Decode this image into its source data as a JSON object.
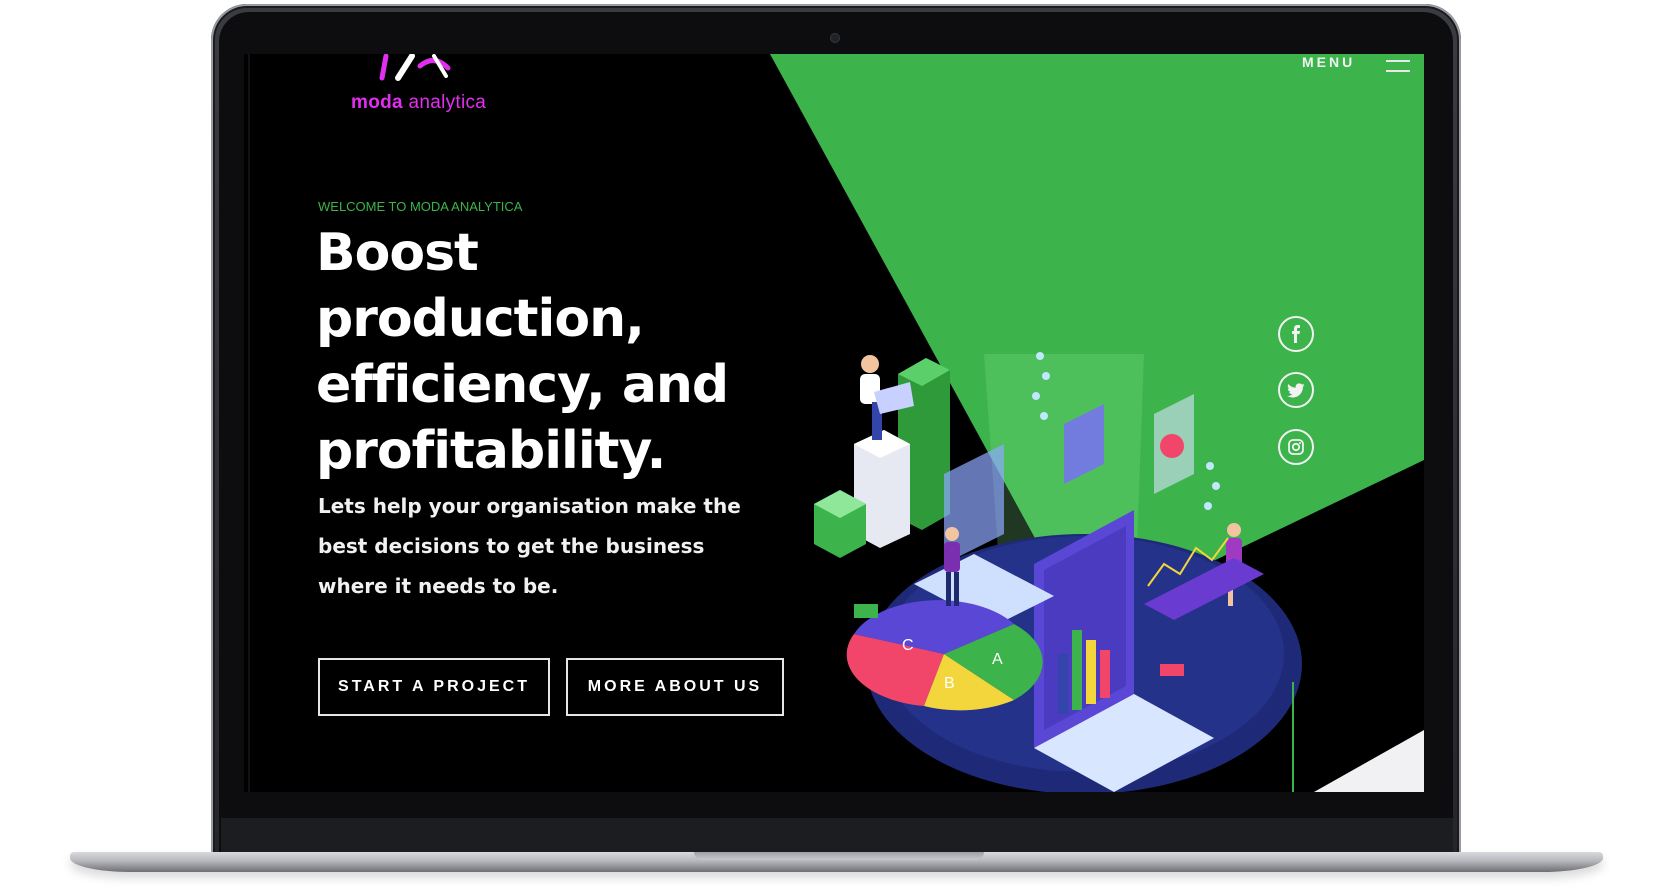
{
  "logo": {
    "text_bold": "moda",
    "text_light": "analytica",
    "mark_label": "MA"
  },
  "nav": {
    "menu_label": "MENU"
  },
  "hero": {
    "eyebrow": "WELCOME TO MODA ANALYTICA",
    "headline_lines": [
      "Boost",
      "production,",
      "efficiency, and",
      "profitability."
    ],
    "subtext_lines": [
      "Lets help your organisation make the",
      "best decisions to get the business",
      "where it needs to be."
    ],
    "primary_button": "START A PROJECT",
    "secondary_button": "MORE ABOUT US"
  },
  "social": [
    {
      "name": "facebook-icon",
      "glyph": "f"
    },
    {
      "name": "twitter-icon",
      "glyph": "bird"
    },
    {
      "name": "instagram-icon",
      "glyph": "camera"
    }
  ],
  "illustration": {
    "pie_labels": [
      "C",
      "A",
      "B"
    ],
    "description_icon": "isometric-analytics-illustration"
  },
  "colors": {
    "accent_green": "#3cb44b",
    "brand_magenta": "#e12ff0",
    "background": "#000000"
  }
}
